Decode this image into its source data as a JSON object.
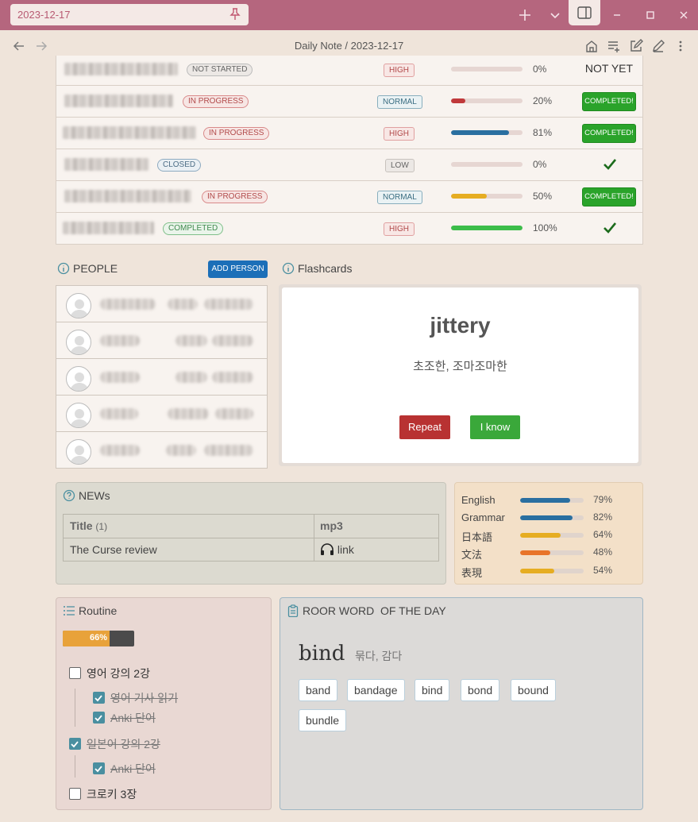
{
  "window": {
    "tab_title": "2023-12-17"
  },
  "nav": {
    "folder": "Daily Note",
    "separator": "/",
    "note": "2023-12-17"
  },
  "tasks": [
    {
      "status": "NOT STARTED",
      "priority": "HIGH",
      "progress": 0,
      "progress_label": "0%",
      "action": "NOT YET",
      "bar_color": "#cfc6bd"
    },
    {
      "status": "IN PROGRESS",
      "priority": "NORMAL",
      "progress": 20,
      "progress_label": "20%",
      "action": "COMPLETED!",
      "bar_color": "#c0393b"
    },
    {
      "status": "IN PROGRESS",
      "priority": "HIGH",
      "progress": 81,
      "progress_label": "81%",
      "action": "COMPLETED!",
      "bar_color": "#2a6fa0"
    },
    {
      "status": "CLOSED",
      "priority": "LOW",
      "progress": 0,
      "progress_label": "0%",
      "action": "check",
      "bar_color": "#cfc6bd"
    },
    {
      "status": "IN PROGRESS",
      "priority": "NORMAL",
      "progress": 50,
      "progress_label": "50%",
      "action": "COMPLETED!",
      "bar_color": "#e6ad22"
    },
    {
      "status": "COMPLETED",
      "priority": "HIGH",
      "progress": 100,
      "progress_label": "100%",
      "action": "check",
      "bar_color": "#3cbd4a"
    }
  ],
  "people": {
    "title": "PEOPLE",
    "add_label": "ADD PERSON"
  },
  "flashcards": {
    "title": "Flashcards",
    "word": "jittery",
    "meaning": "초조한, 조마조마한",
    "repeat_label": "Repeat",
    "know_label": "I know"
  },
  "news": {
    "title": "NEWs",
    "col_title": "Title",
    "col_count": "(1)",
    "col_mp3": "mp3",
    "row_title": "The Curse review",
    "row_link": "link"
  },
  "skills": [
    {
      "name": "English",
      "value": 79,
      "label": "79%",
      "color": "#2a6fa0"
    },
    {
      "name": "Grammar",
      "value": 82,
      "label": "82%",
      "color": "#2a6fa0"
    },
    {
      "name": "日本語",
      "value": 64,
      "label": "64%",
      "color": "#e6ad22"
    },
    {
      "name": "文法",
      "value": 48,
      "label": "48%",
      "color": "#e8742a"
    },
    {
      "name": "表現",
      "value": 54,
      "label": "54%",
      "color": "#e6ad22"
    }
  ],
  "routine": {
    "title": "Routine",
    "progress": 66,
    "progress_label": "66%",
    "items": [
      {
        "label": "영어 강의 2강",
        "checked": false
      },
      {
        "label": "영어 기사 읽기",
        "checked": true
      },
      {
        "label": "Anki 단어",
        "checked": true
      },
      {
        "label": "일본어 강의 2강",
        "checked": true
      },
      {
        "label": "Anki 단어",
        "checked": true
      },
      {
        "label": "크로키 3장",
        "checked": false
      }
    ]
  },
  "root_word": {
    "title": "ROOR WORD  OF THE DAY",
    "word": "bind",
    "meaning": "묶다, 감다",
    "tags": [
      "band",
      "bandage",
      "bind",
      "bond",
      "bound",
      "bundle"
    ]
  }
}
